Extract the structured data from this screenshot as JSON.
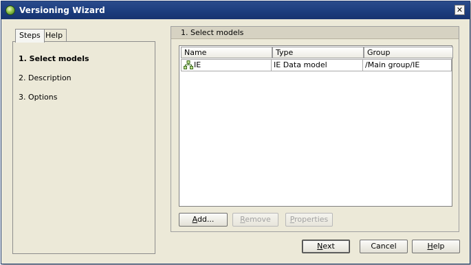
{
  "window": {
    "title": "Versioning Wizard",
    "close_glyph": "✕"
  },
  "tabs": [
    {
      "label": "Steps"
    },
    {
      "label": "Help"
    }
  ],
  "steps": [
    {
      "label": "1. Select models"
    },
    {
      "label": "2. Description"
    },
    {
      "label": "3. Options"
    }
  ],
  "panel": {
    "header": "1. Select models"
  },
  "table": {
    "columns": [
      "Name",
      "Type",
      "Group"
    ],
    "rows": [
      {
        "icon": "data-model-icon",
        "name": "IE",
        "type": "IE Data model",
        "group": "/Main group/IE"
      }
    ]
  },
  "buttons": {
    "add": {
      "mnemonic": "A",
      "rest": "dd..."
    },
    "remove": {
      "mnemonic": "R",
      "rest": "emove"
    },
    "properties": {
      "mnemonic": "P",
      "rest": "roperties"
    },
    "next": {
      "mnemonic": "N",
      "rest": "ext"
    },
    "cancel": "Cancel",
    "help": {
      "mnemonic": "H",
      "rest": "elp"
    }
  },
  "colors": {
    "titlebar": "#1c3d7e",
    "background": "#ece9d8",
    "panel_header": "#d6d2c2"
  }
}
